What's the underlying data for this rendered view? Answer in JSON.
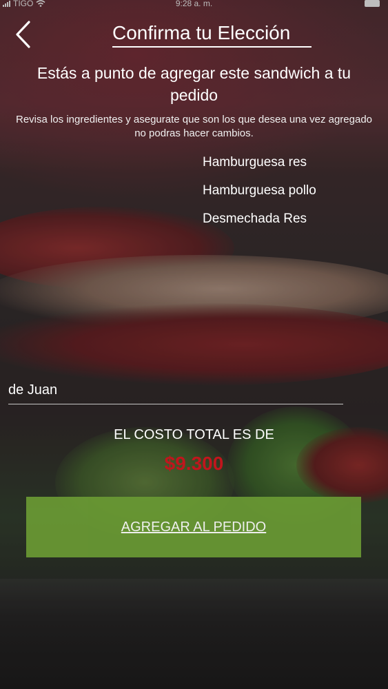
{
  "status_bar": {
    "carrier": "TIGO",
    "time": "9:28 a. m."
  },
  "header": {
    "title": "Confirma tu Elección"
  },
  "content": {
    "lead": "Estás a punto de agregar este sandwich a tu pedido",
    "note": "Revisa los ingredientes y asegurate que son los que desea una vez agregado no podras hacer cambios.",
    "ingredients": [
      "Hamburguesa res",
      "Hamburguesa pollo",
      "Desmechada Res"
    ]
  },
  "form": {
    "name_value": "de Juan"
  },
  "total": {
    "label": "EL COSTO TOTAL ES DE",
    "amount": "$9.300"
  },
  "actions": {
    "add_label": "AGREGAR AL PEDIDO"
  },
  "colors": {
    "price": "#c0161d",
    "button": "#6a9a34",
    "text": "#ffffff"
  }
}
